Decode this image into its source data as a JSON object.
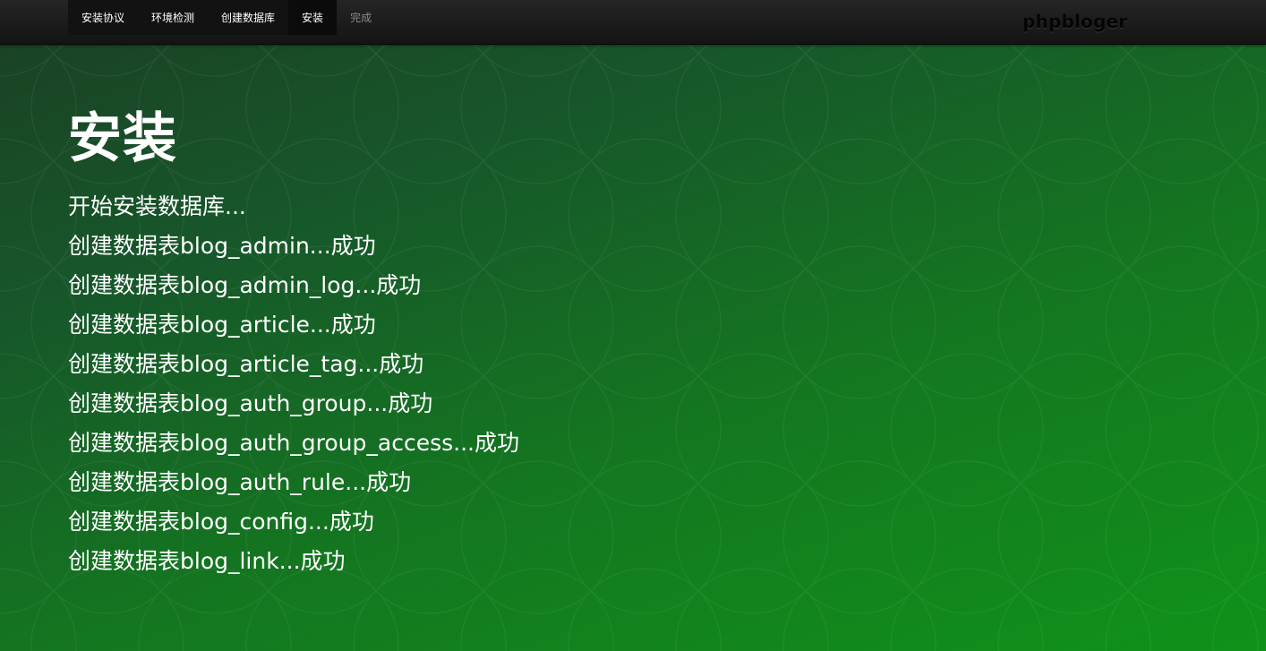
{
  "navbar": {
    "steps": [
      {
        "label": "安装协议",
        "state": "done"
      },
      {
        "label": "环境检测",
        "state": "done"
      },
      {
        "label": "创建数据库",
        "state": "done"
      },
      {
        "label": "安装",
        "state": "current"
      },
      {
        "label": "完成",
        "state": "pending"
      }
    ],
    "brand": "phpbloger"
  },
  "main": {
    "title": "安装",
    "log": [
      "开始安装数据库...",
      "创建数据表blog_admin...成功",
      "创建数据表blog_admin_log...成功",
      "创建数据表blog_article...成功",
      "创建数据表blog_article_tag...成功",
      "创建数据表blog_auth_group...成功",
      "创建数据表blog_auth_group_access...成功",
      "创建数据表blog_auth_rule...成功",
      "创建数据表blog_config...成功",
      "创建数据表blog_link...成功"
    ]
  },
  "colors": {
    "navbar_bg": "#1a1a1a",
    "page_bg_dark": "#1b3f25",
    "page_bg_light": "#10921a",
    "text": "#ffffff",
    "pending_step": "#8a8a8a"
  }
}
